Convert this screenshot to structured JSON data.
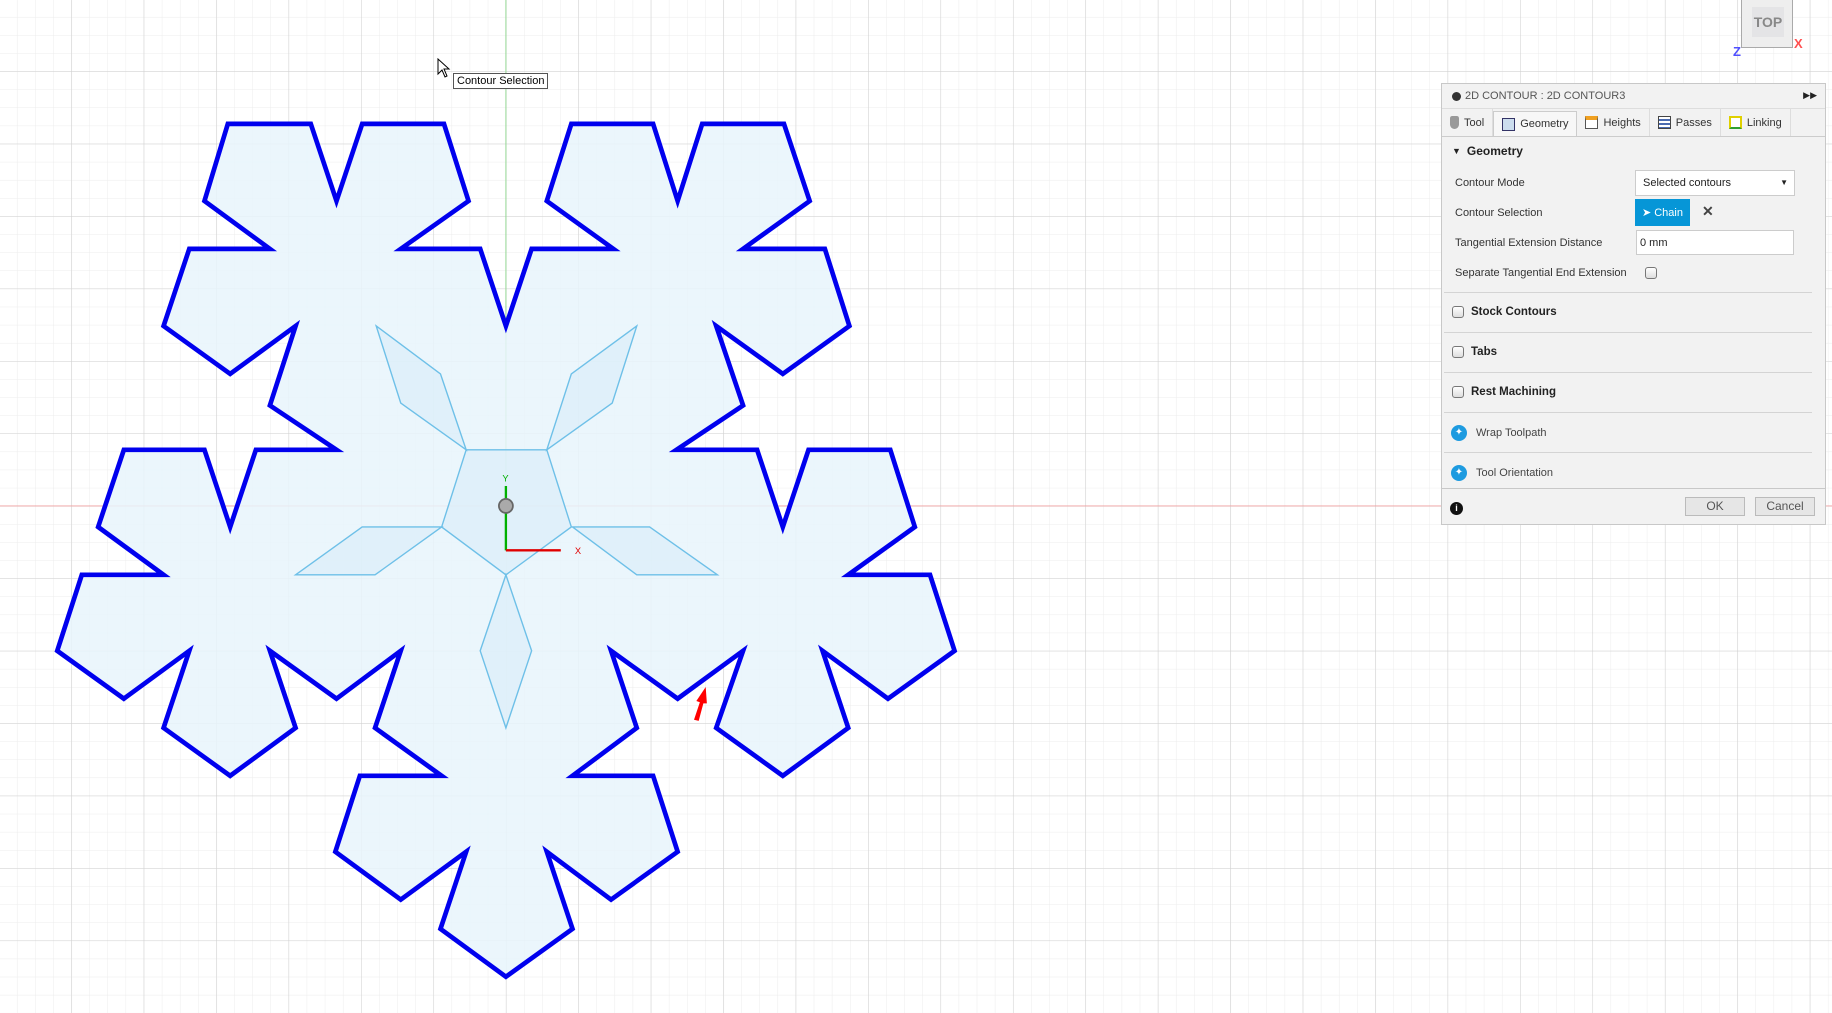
{
  "viewport": {
    "tooltip": "Contour Selection",
    "viewcube_label": "TOP",
    "axis_x": "X",
    "axis_z": "Z",
    "origin_x_label": "X",
    "origin_y_label": "Y",
    "colors": {
      "contour": "#0000ee",
      "fill": "#e8f4fc",
      "sketch_lines": "#6ec0e8",
      "x_axis": "#e00000",
      "y_axis": "#00b000"
    }
  },
  "panel": {
    "title": "2D CONTOUR : 2D CONTOUR3",
    "tabs": [
      {
        "label": "Tool",
        "icon": "tool-icon"
      },
      {
        "label": "Geometry",
        "icon": "geometry-icon",
        "active": true
      },
      {
        "label": "Heights",
        "icon": "heights-icon"
      },
      {
        "label": "Passes",
        "icon": "passes-icon"
      },
      {
        "label": "Linking",
        "icon": "linking-icon"
      }
    ],
    "geometry": {
      "header": "Geometry",
      "contour_mode_label": "Contour Mode",
      "contour_mode_value": "Selected contours",
      "contour_selection_label": "Contour Selection",
      "chain_label": "Chain",
      "tangential_label": "Tangential Extension Distance",
      "tangential_value": "0 mm",
      "separate_label": "Separate Tangential End Extension",
      "separate_checked": false
    },
    "groups": [
      {
        "label": "Stock Contours",
        "checked": false
      },
      {
        "label": "Tabs",
        "checked": false
      },
      {
        "label": "Rest Machining",
        "checked": false
      }
    ],
    "extras": [
      "Wrap Toolpath",
      "Tool Orientation"
    ],
    "ok_label": "OK",
    "cancel_label": "Cancel"
  }
}
